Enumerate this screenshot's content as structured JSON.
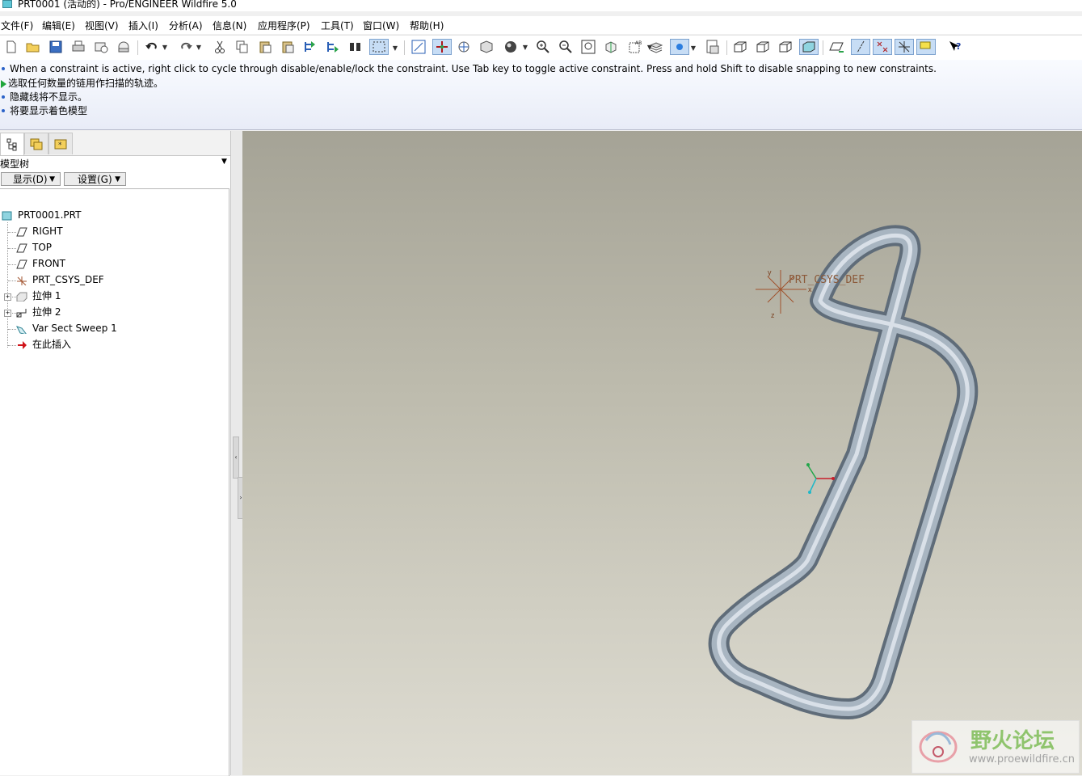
{
  "window": {
    "title": "PRT0001 (活动的) - Pro/ENGINEER Wildfire 5.0"
  },
  "menubar": {
    "items": [
      {
        "label": "文件(F)"
      },
      {
        "label": "编辑(E)"
      },
      {
        "label": "视图(V)"
      },
      {
        "label": "插入(I)"
      },
      {
        "label": "分析(A)"
      },
      {
        "label": "信息(N)"
      },
      {
        "label": "应用程序(P)"
      },
      {
        "label": "工具(T)"
      },
      {
        "label": "窗口(W)"
      },
      {
        "label": "帮助(H)"
      }
    ]
  },
  "toolbar": {
    "icons": [
      "new-icon",
      "open-icon",
      "save-icon",
      "print-icon",
      "email-icon",
      "email-link-icon",
      "undo-icon",
      "redo-icon",
      "cut-icon",
      "copy-icon",
      "paste-icon",
      "paste-special-icon",
      "regenerate-icon",
      "regen-manager-icon",
      "find-icon",
      "selection-box-icon",
      "repaint-icon",
      "spin-center-icon",
      "orient-mode-icon",
      "saved-views-icon",
      "shading-icon",
      "zoom-in-icon",
      "zoom-out-icon",
      "refit-icon",
      "reorient-icon",
      "saved-view-list-icon",
      "layers-icon",
      "appearance-icon",
      "view-manager-icon",
      "wireframe-icon",
      "hidden-line-icon",
      "no-hidden-icon",
      "shading-mode-icon",
      "datum-planes-icon",
      "datum-axes-icon",
      "datum-points-icon",
      "coordinate-systems-icon",
      "context-help-icon"
    ]
  },
  "messages": [
    {
      "type": "info",
      "text": "When a constraint is active, right click to cycle through disable/enable/lock the constraint. Use Tab key to toggle active constraint. Press and hold Shift to disable snapping to new constraints."
    },
    {
      "type": "prompt",
      "text": "选取任何数量的链用作扫描的轨迹。"
    },
    {
      "type": "info",
      "text": "隐藏线将不显示。"
    },
    {
      "type": "info",
      "text": "将要显示着色模型"
    }
  ],
  "leftpanel": {
    "title": "模型树",
    "show_button": "显示(D)",
    "settings_button": "设置(G)",
    "tree": [
      {
        "label": "PRT0001.PRT",
        "icon": "part-icon"
      },
      {
        "label": "RIGHT",
        "icon": "datum-plane-icon"
      },
      {
        "label": "TOP",
        "icon": "datum-plane-icon"
      },
      {
        "label": "FRONT",
        "icon": "datum-plane-icon"
      },
      {
        "label": "PRT_CSYS_DEF",
        "icon": "csys-icon"
      },
      {
        "label": "拉伸 1",
        "icon": "extrude-icon"
      },
      {
        "label": "拉伸 2",
        "icon": "extrude-icon"
      },
      {
        "label": "Var Sect Sweep 1",
        "icon": "var-sect-sweep-icon"
      },
      {
        "label": "在此插入",
        "icon": "insert-here-arrow-icon"
      }
    ]
  },
  "viewport": {
    "csys_label": "PRT_CSYS_DEF",
    "csys_axes": {
      "x": "x",
      "y": "y",
      "z": "z"
    },
    "model_color": "#9fadba",
    "background_top": "#a5a396",
    "background_bottom": "#dedcd2"
  },
  "watermark": {
    "title": "野火论坛",
    "url": "www.proewildfire.cn"
  }
}
